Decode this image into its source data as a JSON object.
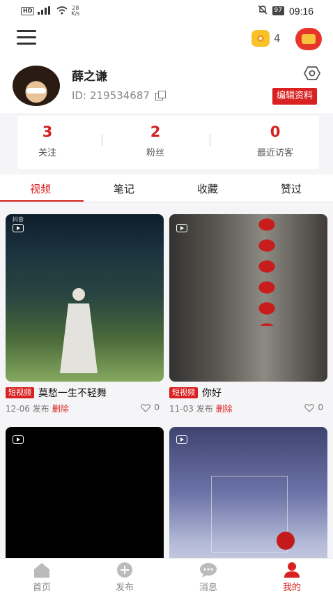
{
  "status_bar": {
    "net_type": "HD",
    "signal": "4G",
    "speed_value": "28",
    "speed_unit": "K/s",
    "battery": "97",
    "time": "09:16"
  },
  "header": {
    "coins": "4"
  },
  "profile": {
    "nickname": "薛之谦",
    "id_label": "ID:",
    "id_value": "219534687",
    "edit_label": "编辑资料"
  },
  "stats": [
    {
      "value": "3",
      "label": "关注"
    },
    {
      "value": "2",
      "label": "粉丝"
    },
    {
      "value": "0",
      "label": "最近访客"
    }
  ],
  "tabs": [
    "视频",
    "笔记",
    "收藏",
    "赞过"
  ],
  "videos": [
    {
      "tag": "短视频",
      "title": "莫愁一生不轻舞",
      "date": "12-06 发布",
      "delete_label": "删除",
      "likes": "0",
      "watermark": "抖音"
    },
    {
      "tag": "短视频",
      "title": "你好",
      "date": "11-03 发布",
      "delete_label": "删除",
      "likes": "0"
    }
  ],
  "bottom_nav": [
    {
      "label": "首页",
      "icon": "home-icon"
    },
    {
      "label": "发布",
      "icon": "plus-icon"
    },
    {
      "label": "消息",
      "icon": "message-icon"
    },
    {
      "label": "我的",
      "icon": "profile-icon"
    }
  ],
  "colors": {
    "accent": "#d92121",
    "coin": "#f9c12a",
    "background": "#f5f5f7"
  }
}
